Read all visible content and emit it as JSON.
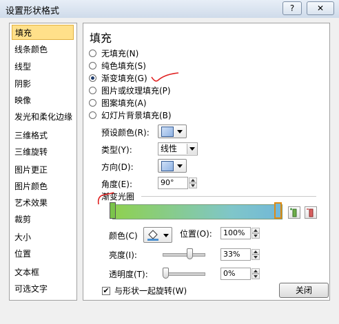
{
  "window": {
    "title": "设置形状格式",
    "help_btn": "?",
    "close_btn": "✕"
  },
  "nav": {
    "items": [
      {
        "label": "填充",
        "active": true
      },
      {
        "label": "线条颜色"
      },
      {
        "label": "线型"
      },
      {
        "label": "阴影"
      },
      {
        "label": "映像"
      },
      {
        "label": "发光和柔化边缘"
      },
      {
        "label": "三维格式"
      },
      {
        "label": "三维旋转"
      },
      {
        "label": "图片更正"
      },
      {
        "label": "图片颜色"
      },
      {
        "label": "艺术效果"
      },
      {
        "label": "裁剪"
      },
      {
        "label": "大小"
      },
      {
        "label": "位置"
      },
      {
        "label": "文本框"
      },
      {
        "label": "可选文字"
      }
    ]
  },
  "panel": {
    "heading": "填充",
    "fill_options": [
      {
        "label": "无填充(N)",
        "selected": false
      },
      {
        "label": "纯色填充(S)",
        "selected": false
      },
      {
        "label": "渐变填充(G)",
        "selected": true
      },
      {
        "label": "图片或纹理填充(P)",
        "selected": false
      },
      {
        "label": "图案填充(A)",
        "selected": false
      },
      {
        "label": "幻灯片背景填充(B)",
        "selected": false
      }
    ],
    "preset_label": "预设颜色(R):",
    "type_label": "类型(Y):",
    "type_value": "线性",
    "direction_label": "方向(D):",
    "angle_label": "角度(E):",
    "angle_value": "90°",
    "gradient_stops_label": "渐变光圈",
    "color_label": "颜色(C)",
    "position_label": "位置(O):",
    "position_value": "100%",
    "brightness_label": "亮度(I):",
    "brightness_value": "33%",
    "brightness_level": 0.33,
    "transparency_label": "透明度(T):",
    "transparency_value": "0%",
    "transparency_level": 0,
    "rotate_label": "与形状一起旋转(W)",
    "rotate_checked": true
  },
  "footer": {
    "close_label": "关闭"
  },
  "colors": {
    "gradient_start": "#8fd14f",
    "gradient_end": "#72b8d8",
    "nav_active": "#ffe08a",
    "annotation_red": "#e02020"
  }
}
